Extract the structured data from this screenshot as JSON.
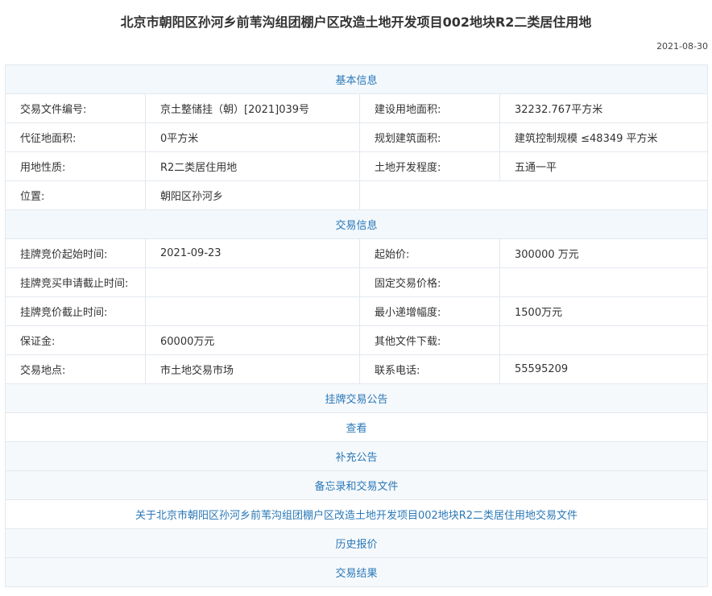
{
  "title": "北京市朝阳区孙河乡前苇沟组团棚户区改造土地开发项目002地块R2二类居住用地",
  "date": "2021-08-30",
  "basic": {
    "heading": "基本信息",
    "file_no_label": "交易文件编号:",
    "file_no": "京土整储挂（朝）[2021]039号",
    "build_area_label": "建设用地面积:",
    "build_area": "32232.767平方米",
    "levy_area_label": "代征地面积:",
    "levy_area": "0平方米",
    "plan_area_label": "规划建筑面积:",
    "plan_area": "建筑控制规模 ≤48349 平方米",
    "land_use_label": "用地性质:",
    "land_use": "R2二类居住用地",
    "dev_level_label": "土地开发程度:",
    "dev_level": "五通一平",
    "location_label": "位置:",
    "location": "朝阳区孙河乡"
  },
  "trade": {
    "heading": "交易信息",
    "start_time_label": "挂牌竞价起始时间:",
    "start_time": "2021-09-23",
    "start_price_label": "起始价:",
    "start_price": "300000 万元",
    "apply_deadline_label": "挂牌竞买申请截止时间:",
    "apply_deadline": "",
    "fixed_price_label": "固定交易价格:",
    "fixed_price": "",
    "bid_deadline_label": "挂牌竞价截止时间:",
    "bid_deadline": "",
    "min_increment_label": "最小递增幅度:",
    "min_increment": "1500万元",
    "deposit_label": "保证金:",
    "deposit": "60000万元",
    "other_files_label": "其他文件下载:",
    "other_files": "",
    "place_label": "交易地点:",
    "place": "市土地交易市场",
    "phone_label": "联系电话:",
    "phone": "55595209"
  },
  "links": {
    "announcement": "挂牌交易公告",
    "view": "查看",
    "supplement": "补充公告",
    "memo": "备忘录和交易文件",
    "trade_file": "关于北京市朝阳区孙河乡前苇沟组团棚户区改造土地开发项目002地块R2二类居住用地交易文件",
    "history": "历史报价",
    "result": "交易结果"
  }
}
